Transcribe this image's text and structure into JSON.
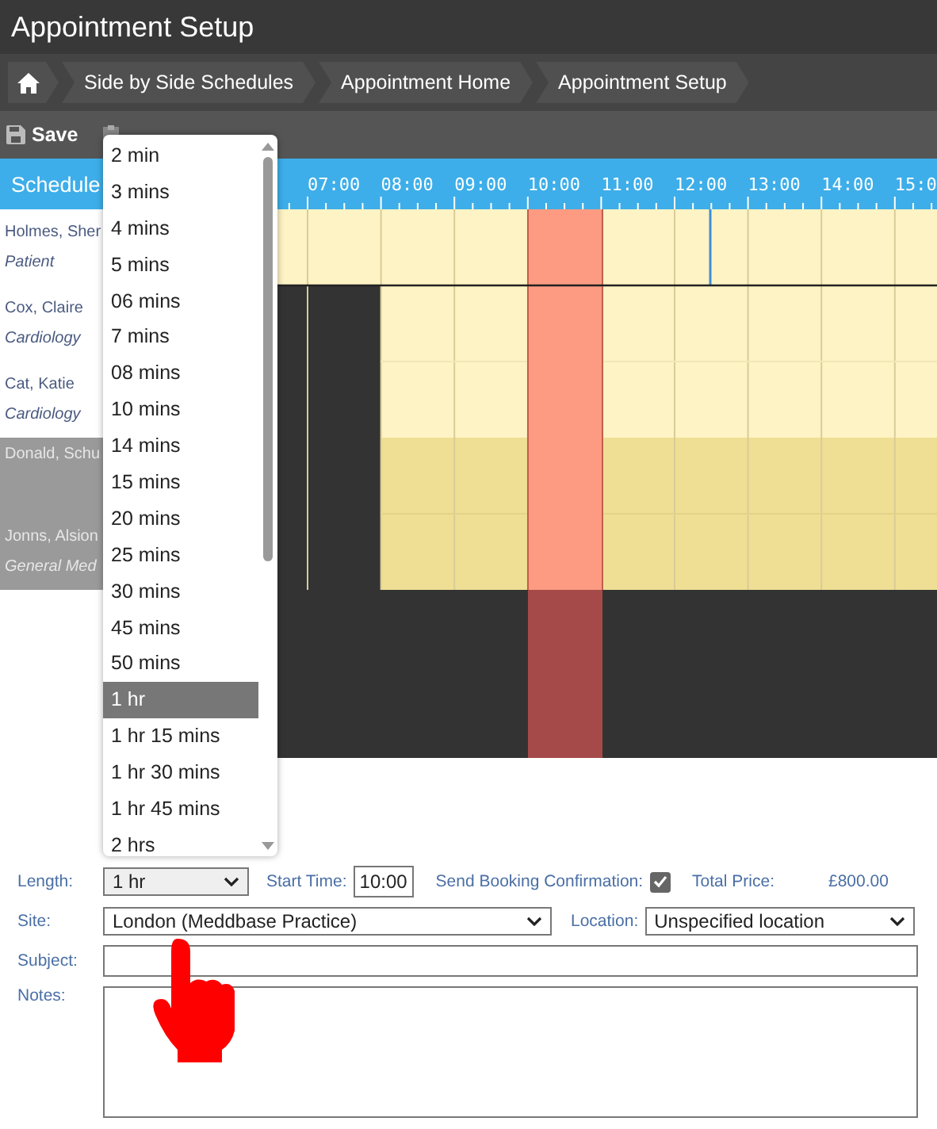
{
  "window": {
    "title": "Appointment Setup"
  },
  "breadcrumb": [
    {
      "label": "Side by Side Schedules"
    },
    {
      "label": "Appointment Home"
    },
    {
      "label": "Appointment Setup"
    }
  ],
  "toolbar": [
    {
      "label": "Save"
    }
  ],
  "schedule": {
    "title": "Schedule",
    "times": [
      "07:00",
      "08:00",
      "09:00",
      "10:00",
      "11:00",
      "12:00",
      "13:00",
      "14:00",
      "15:0"
    ],
    "resources": [
      {
        "name": "Holmes, Sher",
        "role": "Patient",
        "inactive": false
      },
      {
        "name": "Cox, Claire",
        "role": "Cardiology",
        "inactive": false
      },
      {
        "name": "Cat, Katie",
        "role": "Cardiology",
        "inactive": false
      },
      {
        "name": "Donald, Schu",
        "inactive": true
      },
      {
        "name": "Jonns, Alsion",
        "role": "General Med",
        "inactive": true
      }
    ]
  },
  "length_dropdown": {
    "options": [
      {
        "label": "2 min",
        "selected": false
      },
      {
        "label": "3 mins",
        "selected": false
      },
      {
        "label": "4 mins",
        "selected": false
      },
      {
        "label": "5 mins",
        "selected": false
      },
      {
        "label": "06 mins",
        "selected": false
      },
      {
        "label": "7 mins",
        "selected": false
      },
      {
        "label": "08 mins",
        "selected": false
      },
      {
        "label": "10 mins",
        "selected": false
      },
      {
        "label": "14 mins",
        "selected": false
      },
      {
        "label": "15 mins",
        "selected": false
      },
      {
        "label": "20 mins",
        "selected": false
      },
      {
        "label": "25 mins",
        "selected": false
      },
      {
        "label": "30 mins",
        "selected": false
      },
      {
        "label": "45 mins",
        "selected": false
      },
      {
        "label": "50 mins",
        "selected": false
      },
      {
        "label": "1 hr",
        "selected": true
      },
      {
        "label": "1 hr 15 mins",
        "selected": false
      },
      {
        "label": "1 hr 30 mins",
        "selected": false
      },
      {
        "label": "1 hr 45 mins",
        "selected": false
      },
      {
        "label": "2 hrs",
        "selected": false
      }
    ]
  },
  "form": {
    "length": {
      "label": "Length:",
      "value": "1 hr"
    },
    "start_time": {
      "label": "Start Time:",
      "value": "10:00"
    },
    "send_confirmation": {
      "label": "Send Booking Confirmation:",
      "checked": true
    },
    "total_price": {
      "label": "Total Price:",
      "value": "£800.00"
    },
    "site": {
      "label": "Site:",
      "value": "London (Meddbase Practice)"
    },
    "location": {
      "label": "Location:",
      "value": "Unspecified location"
    },
    "subject": {
      "label": "Subject:"
    },
    "notes": {
      "label": "Notes:"
    }
  }
}
